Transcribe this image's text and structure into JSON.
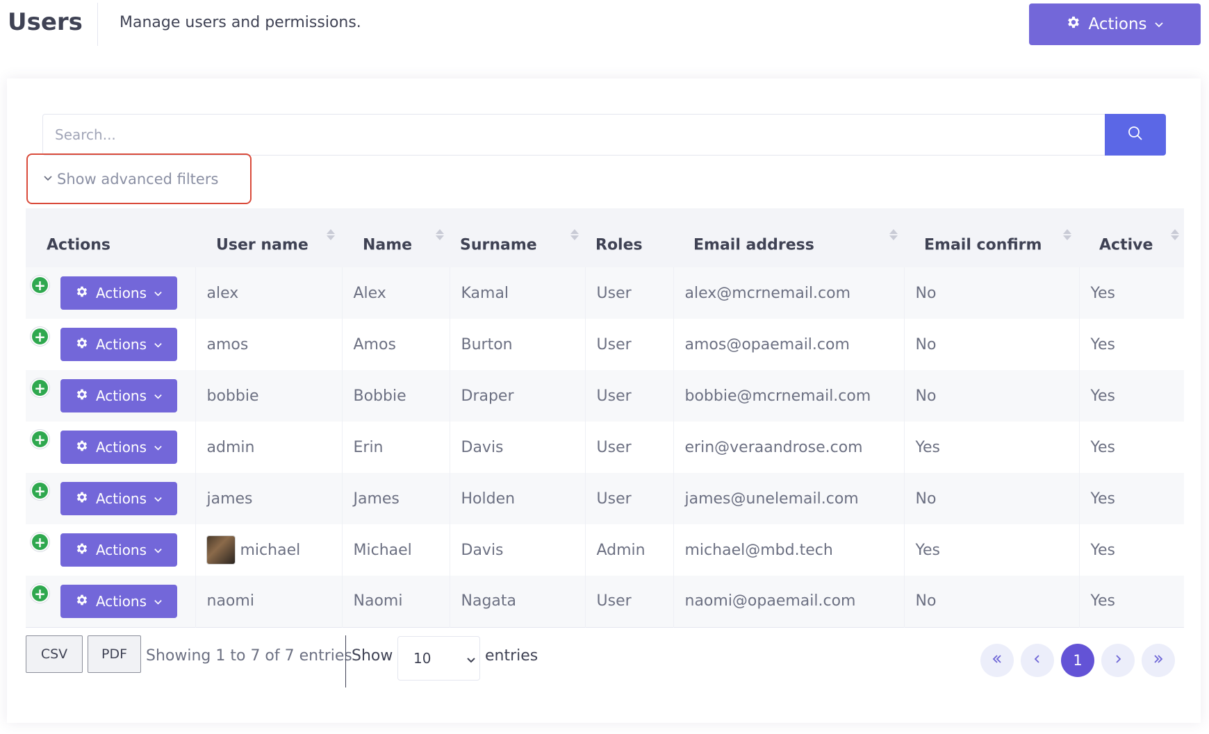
{
  "header": {
    "title": "Users",
    "subtitle": "Manage users and permissions.",
    "actions_label": "Actions",
    "actions_icon": "gear-icon"
  },
  "search": {
    "placeholder": "Search...",
    "value": "",
    "button_icon": "search-icon"
  },
  "advanced_filters": {
    "label": "Show advanced filters",
    "icon": "chevron-down-icon",
    "highlight_color": "#d94a3a"
  },
  "table": {
    "columns": [
      {
        "label": "Actions",
        "sortable": false
      },
      {
        "label": "User name",
        "sortable": true
      },
      {
        "label": "Name",
        "sortable": true
      },
      {
        "label": "Surname",
        "sortable": true
      },
      {
        "label": "Roles",
        "sortable": false
      },
      {
        "label": "Email address",
        "sortable": true
      },
      {
        "label": "Email confirm",
        "sortable": true
      },
      {
        "label": "Active",
        "sortable": true
      }
    ],
    "row_action_label": "Actions",
    "rows": [
      {
        "username": "alex",
        "name": "Alex",
        "surname": "Kamal",
        "roles": "User",
        "email": "alex@mcrnemail.com",
        "email_confirm": "No",
        "active": "Yes",
        "has_avatar": false
      },
      {
        "username": "amos",
        "name": "Amos",
        "surname": "Burton",
        "roles": "User",
        "email": "amos@opaemail.com",
        "email_confirm": "No",
        "active": "Yes",
        "has_avatar": false
      },
      {
        "username": "bobbie",
        "name": "Bobbie",
        "surname": "Draper",
        "roles": "User",
        "email": "bobbie@mcrnemail.com",
        "email_confirm": "No",
        "active": "Yes",
        "has_avatar": false
      },
      {
        "username": "admin",
        "name": "Erin",
        "surname": "Davis",
        "roles": "User",
        "email": "erin@veraandrose.com",
        "email_confirm": "Yes",
        "active": "Yes",
        "has_avatar": false
      },
      {
        "username": "james",
        "name": "James",
        "surname": "Holden",
        "roles": "User",
        "email": "james@unelemail.com",
        "email_confirm": "No",
        "active": "Yes",
        "has_avatar": false
      },
      {
        "username": "michael",
        "name": "Michael",
        "surname": "Davis",
        "roles": "Admin",
        "email": "michael@mbd.tech",
        "email_confirm": "Yes",
        "active": "Yes",
        "has_avatar": true
      },
      {
        "username": "naomi",
        "name": "Naomi",
        "surname": "Nagata",
        "roles": "User",
        "email": "naomi@opaemail.com",
        "email_confirm": "No",
        "active": "Yes",
        "has_avatar": false
      }
    ]
  },
  "footer": {
    "csv_label": "CSV",
    "pdf_label": "PDF",
    "showing_text": "Showing 1 to 7 of 7 entries",
    "show_label": "Show",
    "page_length": "10",
    "entries_label": "entries",
    "pagination": {
      "first_icon": "double-chevron-left-icon",
      "prev_icon": "chevron-left-icon",
      "current_page": "1",
      "next_icon": "chevron-right-icon",
      "last_icon": "double-chevron-right-icon"
    }
  },
  "colors": {
    "primary": "#7367d9",
    "search_button": "#5b67e6",
    "success": "#2fa84f",
    "pagination_active": "#6353d6"
  }
}
